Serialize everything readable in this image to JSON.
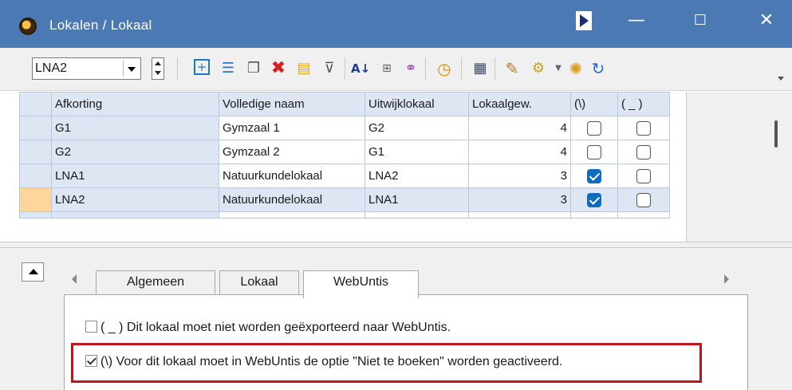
{
  "window": {
    "title": "Lokalen / Lokaal",
    "minimize_glyph": "—",
    "maximize_glyph": "☐",
    "close_glyph": "✕"
  },
  "toolbar": {
    "selector_value": "LNA2",
    "icons": [
      "new-row-icon",
      "list-icon",
      "new-item-icon",
      "delete-icon",
      "edit-icon",
      "filter-icon",
      "sort-icon",
      "table-icon",
      "link-icon",
      "clock-icon",
      "calendar-icon",
      "palette-icon",
      "document-settings-icon",
      "gear-icon",
      "refresh-icon"
    ]
  },
  "grid": {
    "columns": [
      "Afkorting",
      "Volledige naam",
      "Uitwijklokaal",
      "Lokaalgew.",
      "(\\)",
      "( _ )"
    ],
    "rows": [
      {
        "afkorting": "G1",
        "naam": "Gymzaal 1",
        "uitwijk": "G2",
        "gewicht": "4",
        "niet_boeken": false,
        "niet_export": false
      },
      {
        "afkorting": "G2",
        "naam": "Gymzaal 2",
        "uitwijk": "G1",
        "gewicht": "4",
        "niet_boeken": false,
        "niet_export": false
      },
      {
        "afkorting": "LNA1",
        "naam": "Natuurkundelokaal",
        "uitwijk": "LNA2",
        "gewicht": "3",
        "niet_boeken": true,
        "niet_export": false
      },
      {
        "afkorting": "LNA2",
        "naam": "Natuurkundelokaal",
        "uitwijk": "LNA1",
        "gewicht": "3",
        "niet_boeken": true,
        "niet_export": false
      }
    ]
  },
  "tabs": [
    {
      "label": "Algemeen",
      "active": false
    },
    {
      "label": "Lokaal",
      "active": false
    },
    {
      "label": "WebUntis",
      "active": true
    }
  ],
  "options": {
    "no_export_label": "( _ ) Dit lokaal moet niet worden geëxporteerd naar WebUntis.",
    "no_export_checked": false,
    "not_bookable_label": "(\\) Voor dit lokaal moet in WebUntis de optie \"Niet te boeken\" worden geactiveerd.",
    "not_bookable_checked": true
  },
  "colors": {
    "titlebar": "#4a79b3",
    "highlight": "#c0151b",
    "checkbox_checked": "#0f6cbd",
    "current_row_indicator": "#fcd69b"
  }
}
